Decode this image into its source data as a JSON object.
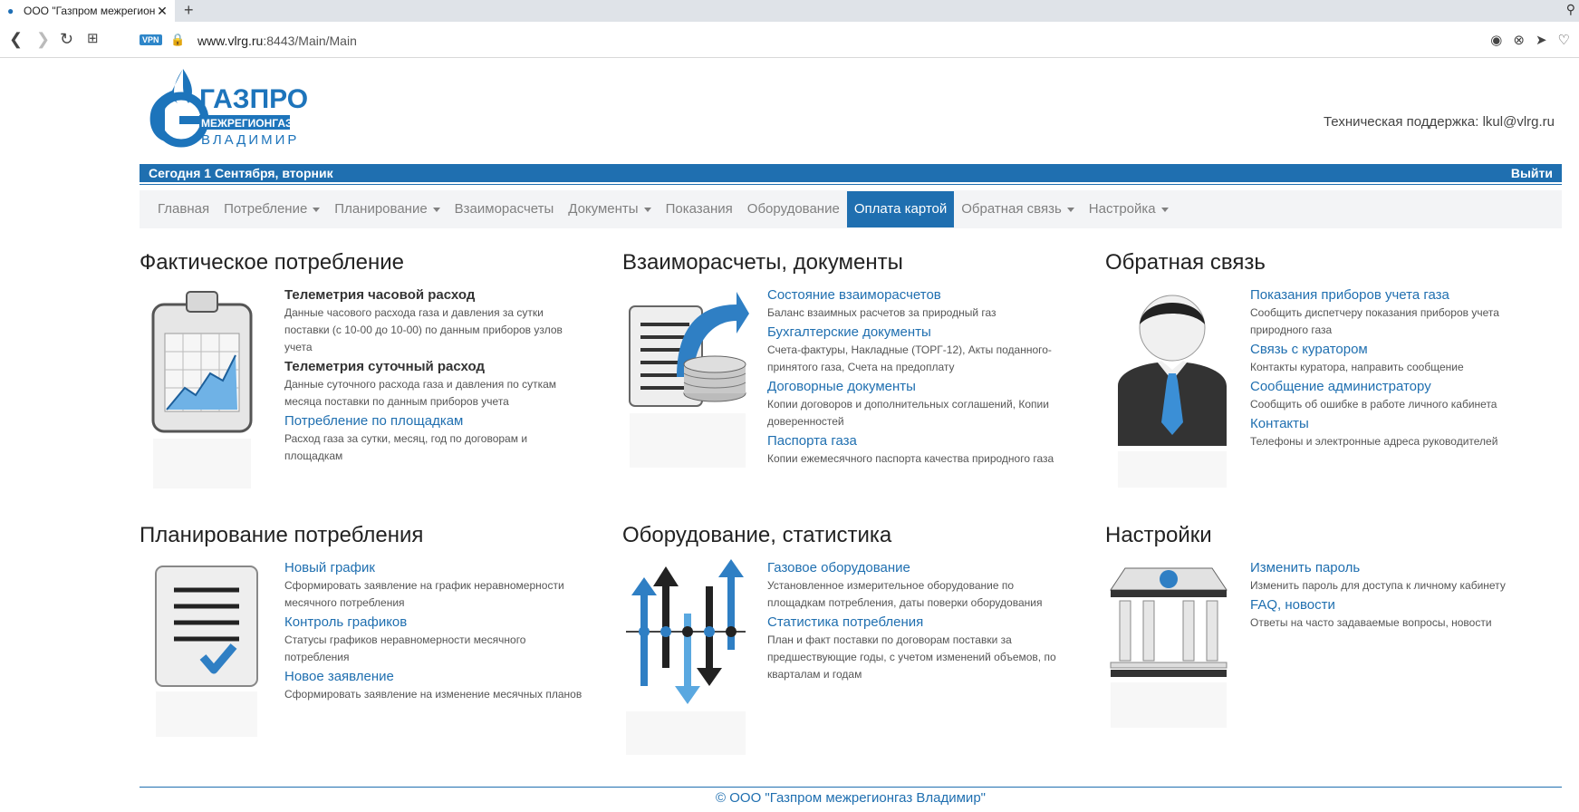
{
  "browser": {
    "tab_title": "ООО \"Газпром межрегион",
    "url_host": "www.vlrg.ru",
    "url_path": ":8443/Main/Main",
    "vpn_label": "VPN"
  },
  "header": {
    "logo_main": "ГАЗПРОМ",
    "logo_sub": "МЕЖРЕГИОНГАЗ",
    "logo_city": "ВЛАДИМИР",
    "support": "Техническая поддержка: lkul@vlrg.ru",
    "date": "Сегодня 1 Сентября, вторник",
    "logout": "Выйти"
  },
  "nav": [
    {
      "label": "Главная",
      "dropdown": false
    },
    {
      "label": "Потребление",
      "dropdown": true
    },
    {
      "label": "Планирование",
      "dropdown": true
    },
    {
      "label": "Взаиморасчеты",
      "dropdown": false
    },
    {
      "label": "Документы",
      "dropdown": true
    },
    {
      "label": "Показания",
      "dropdown": false
    },
    {
      "label": "Оборудование",
      "dropdown": false
    },
    {
      "label": "Оплата картой",
      "dropdown": false,
      "active": true
    },
    {
      "label": "Обратная связь",
      "dropdown": true
    },
    {
      "label": "Настройка",
      "dropdown": true
    }
  ],
  "sections": {
    "consumption": {
      "title": "Фактическое потребление",
      "items": [
        {
          "title": "Телеметрия часовой расход",
          "desc": "Данные часового расхода газа и давления за сутки поставки (с 10-00 до 10-00) по данным приборов узлов учета"
        },
        {
          "title": "Телеметрия суточный расход",
          "desc": "Данные суточного расхода газа и давления по суткам месяца поставки по данным приборов учета"
        },
        {
          "title": "Потребление по площадкам",
          "desc": "Расход газа за сутки, месяц, год по договорам и площадкам"
        }
      ]
    },
    "settlements": {
      "title": "Взаиморасчеты, документы",
      "items": [
        {
          "title": "Состояние взаиморасчетов",
          "desc": "Баланс взаимных расчетов за природный газ"
        },
        {
          "title": "Бухгалтерские документы",
          "desc": "Счета-фактуры, Накладные (ТОРГ-12), Акты поданного-принятого газа, Счета на предоплату"
        },
        {
          "title": "Договорные документы",
          "desc": "Копии договоров и дополнительных соглашений, Копии доверенностей"
        },
        {
          "title": "Паспорта газа",
          "desc": "Копии ежемесячного паспорта качества природного газа"
        }
      ]
    },
    "feedback": {
      "title": "Обратная связь",
      "items": [
        {
          "title": "Показания приборов учета газа",
          "desc": "Сообщить диспетчеру показания приборов учета природного газа"
        },
        {
          "title": "Связь с куратором",
          "desc": "Контакты куратора, направить сообщение"
        },
        {
          "title": "Сообщение администратору",
          "desc": "Сообщить об ошибке в работе личного кабинета"
        },
        {
          "title": "Контакты",
          "desc": "Телефоны и электронные адреса руководителей"
        }
      ]
    },
    "planning": {
      "title": "Планирование потребления",
      "items": [
        {
          "title": "Новый график",
          "desc": "Сформировать заявление на график неравномерности месячного потребления"
        },
        {
          "title": "Контроль графиков",
          "desc": "Статусы графиков неравномерности месячного потребления"
        },
        {
          "title": "Новое заявление",
          "desc": "Сформировать заявление на изменение месячных планов"
        }
      ]
    },
    "equipment": {
      "title": "Оборудование, статистика",
      "items": [
        {
          "title": "Газовое оборудование",
          "desc": "Установленное измерительное оборудование по площадкам потребления, даты поверки оборудования"
        },
        {
          "title": "Статистика потребления",
          "desc": "План и факт поставки по договорам поставки за предшествующие годы, с учетом изменений объемов, по кварталам и годам"
        }
      ]
    },
    "settings": {
      "title": "Настройки",
      "items": [
        {
          "title": "Изменить пароль",
          "desc": "Изменить пароль для доступа к личному кабинету"
        },
        {
          "title": "FAQ, новости",
          "desc": "Ответы на часто задаваемые вопросы, новости"
        }
      ]
    }
  },
  "footer": "© ООО \"Газпром межрегионгаз Владимир\""
}
